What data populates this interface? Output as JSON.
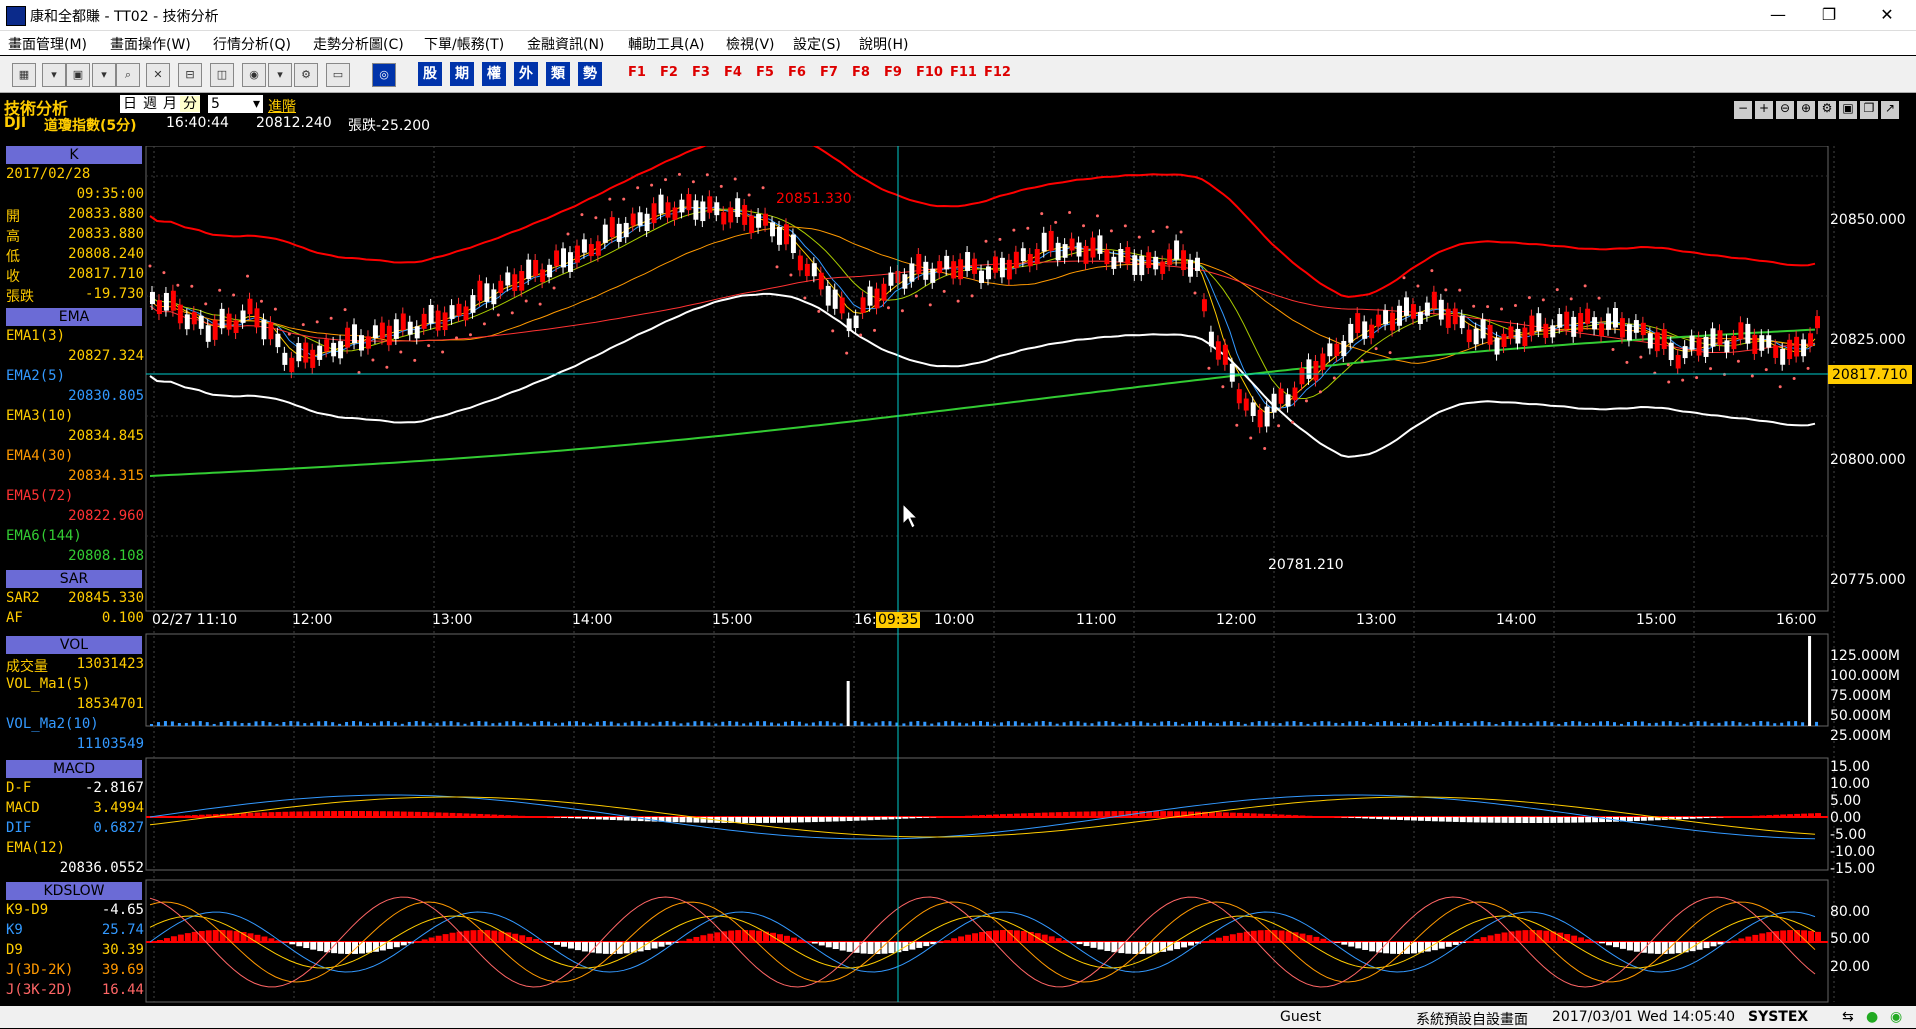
{
  "window": {
    "title": "康和全都賺 - TT02 - 技術分析",
    "minimize": "—",
    "maximize": "❐",
    "close": "✕"
  },
  "menu": [
    "畫面管理(M)",
    "畫面操作(W)",
    "行情分析(Q)",
    "走勢分析圖(C)",
    "下單/帳務(T)",
    "金融資訊(N)",
    "輔助工具(A)",
    "檢視(V)",
    "設定(S)",
    "說明(H)"
  ],
  "toolbar": {
    "category_buttons": [
      "股",
      "期",
      "權",
      "外",
      "類",
      "勢"
    ],
    "function_keys": [
      "F1",
      "F2",
      "F3",
      "F4",
      "F5",
      "F6",
      "F7",
      "F8",
      "F9",
      "F10",
      "F11",
      "F12"
    ]
  },
  "header": {
    "section_title": "技術分析",
    "period_buttons": [
      "日",
      "週",
      "月",
      "分"
    ],
    "period_value": "5",
    "advanced": "進階",
    "symbol": "DJI",
    "symbol_name": "道瓊指數(5分)",
    "time": "16:40:44",
    "price": "20812.240",
    "change": "張跌-25.200"
  },
  "panels": {
    "k": {
      "title": "K",
      "date": "2017/02/28",
      "time": "09:35:00",
      "rows": [
        {
          "label": "開",
          "value": "20833.880"
        },
        {
          "label": "高",
          "value": "20833.880"
        },
        {
          "label": "低",
          "value": "20808.240"
        },
        {
          "label": "收",
          "value": "20817.710"
        },
        {
          "label": "張跌",
          "value": "-19.730"
        }
      ]
    },
    "ema": {
      "title": "EMA",
      "rows": [
        {
          "label": "EMA1(3)",
          "value": "20827.324",
          "color": "#ffcc00"
        },
        {
          "label": "EMA2(5)",
          "value": "20830.805",
          "color": "#3399ff"
        },
        {
          "label": "EMA3(10)",
          "value": "20834.845",
          "color": "#ffcc00"
        },
        {
          "label": "EMA4(30)",
          "value": "20834.315",
          "color": "#ff9900"
        },
        {
          "label": "EMA5(72)",
          "value": "20822.960",
          "color": "#ff3333"
        },
        {
          "label": "EMA6(144)",
          "value": "20808.108",
          "color": "#33cc33"
        }
      ]
    },
    "sar": {
      "title": "SAR",
      "rows": [
        {
          "label": "SAR2",
          "value": "20845.330"
        },
        {
          "label": "AF",
          "value": "0.100"
        }
      ]
    },
    "vol": {
      "title": "VOL",
      "rows": [
        {
          "label": "成交量",
          "value": "13031423"
        },
        {
          "label": "VOL_Ma1(5)",
          "value": ""
        },
        {
          "label": "",
          "value": "18534701"
        },
        {
          "label": "VOL_Ma2(10)",
          "value": ""
        },
        {
          "label": "",
          "value": "11103549"
        }
      ]
    },
    "macd": {
      "title": "MACD",
      "rows": [
        {
          "label": "D-F",
          "value": "-2.8167"
        },
        {
          "label": "MACD",
          "value": "3.4994"
        },
        {
          "label": "DIF",
          "value": "0.6827"
        },
        {
          "label": "EMA(12)",
          "value": ""
        },
        {
          "label": "",
          "value": "20836.0552"
        }
      ]
    },
    "kd": {
      "title": "KDSLOW",
      "rows": [
        {
          "label": "K9-D9",
          "value": "-4.65"
        },
        {
          "label": "K9",
          "value": "25.74"
        },
        {
          "label": "D9",
          "value": "30.39"
        },
        {
          "label": "J(3D-2K)",
          "value": "39.69"
        },
        {
          "label": "J(3K-2D)",
          "value": "16.44"
        }
      ]
    }
  },
  "chart_data": {
    "type": "candlestick",
    "price_axis": [
      "20850.000",
      "20825.000",
      "20800.000",
      "20775.000"
    ],
    "current_price_tag": "20817.710",
    "annotations": [
      {
        "text": "20851.330"
      },
      {
        "text": "20781.210"
      }
    ],
    "time_axis": [
      "02/27 11:10",
      "12:00",
      "13:00",
      "14:00",
      "15:00",
      "16:",
      "09:35",
      "10:00",
      "11:00",
      "12:00",
      "13:00",
      "14:00",
      "15:00",
      "16:00"
    ],
    "volume_axis": [
      "125.000M",
      "100.000M",
      "75.000M",
      "50.000M",
      "25.000M"
    ],
    "macd_axis": [
      "15.00",
      "10.00",
      "5.00",
      "0.00",
      "-5.00",
      "-10.00",
      "-15.00"
    ],
    "kd_axis": [
      "80.00",
      "50.00",
      "20.00"
    ]
  },
  "status": {
    "user": "Guest",
    "layout": "系統預設自設畫面",
    "datetime": "2017/03/01 Wed 14:05:40",
    "brand": "SYSTEX"
  }
}
